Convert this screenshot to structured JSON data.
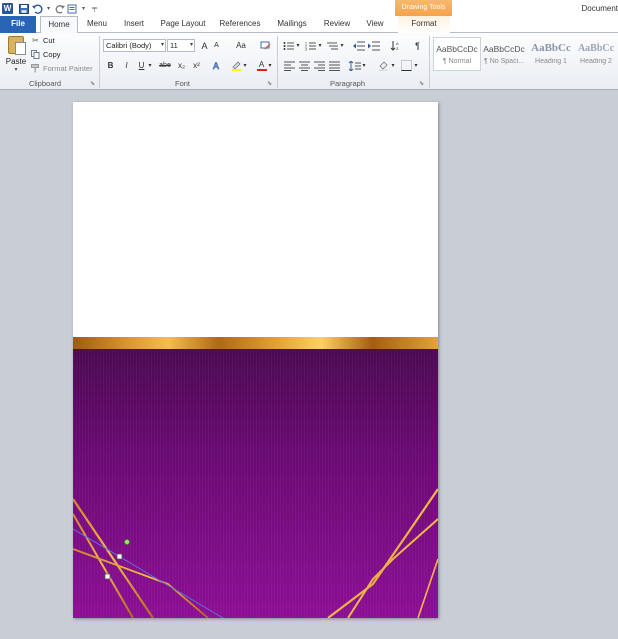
{
  "quick_access": {
    "app_icon_letter": "W"
  },
  "window": {
    "title": "Document"
  },
  "contextual_tab_group": "Drawing Tools",
  "tabs": [
    "File",
    "Home",
    "Menu",
    "Insert",
    "Page Layout",
    "References",
    "Mailings",
    "Review",
    "View",
    "Format"
  ],
  "clipboard": {
    "paste_label": "Paste",
    "cut_label": "Cut",
    "copy_label": "Copy",
    "format_painter_label": "Format Painter",
    "group_label": "Clipboard"
  },
  "font": {
    "family": "Calibri (Body)",
    "size": "11",
    "group_label": "Font",
    "grow_glyph": "A",
    "shrink_glyph": "A",
    "case_glyph": "Aa",
    "bold": "B",
    "italic": "I",
    "underline": "U",
    "strikethrough": "abe",
    "subscript": "x₂",
    "superscript": "x²",
    "font_color_glyph": "A"
  },
  "paragraph": {
    "group_label": "Paragraph",
    "pilcrow": "¶"
  },
  "styles": [
    {
      "sample": "AaBbCcDc",
      "name": "¶ Normal"
    },
    {
      "sample": "AaBbCcDc",
      "name": "¶ No Spaci..."
    },
    {
      "sample": "AaBbCc",
      "name": "Heading 1"
    },
    {
      "sample": "AaBbCc",
      "name": "Heading 2"
    }
  ],
  "colors": {
    "accent_blue": "#2a64b4",
    "contextual_orange": "#f6a24a",
    "page_purple": "#7a0c84",
    "gold": "#e0a03a"
  }
}
